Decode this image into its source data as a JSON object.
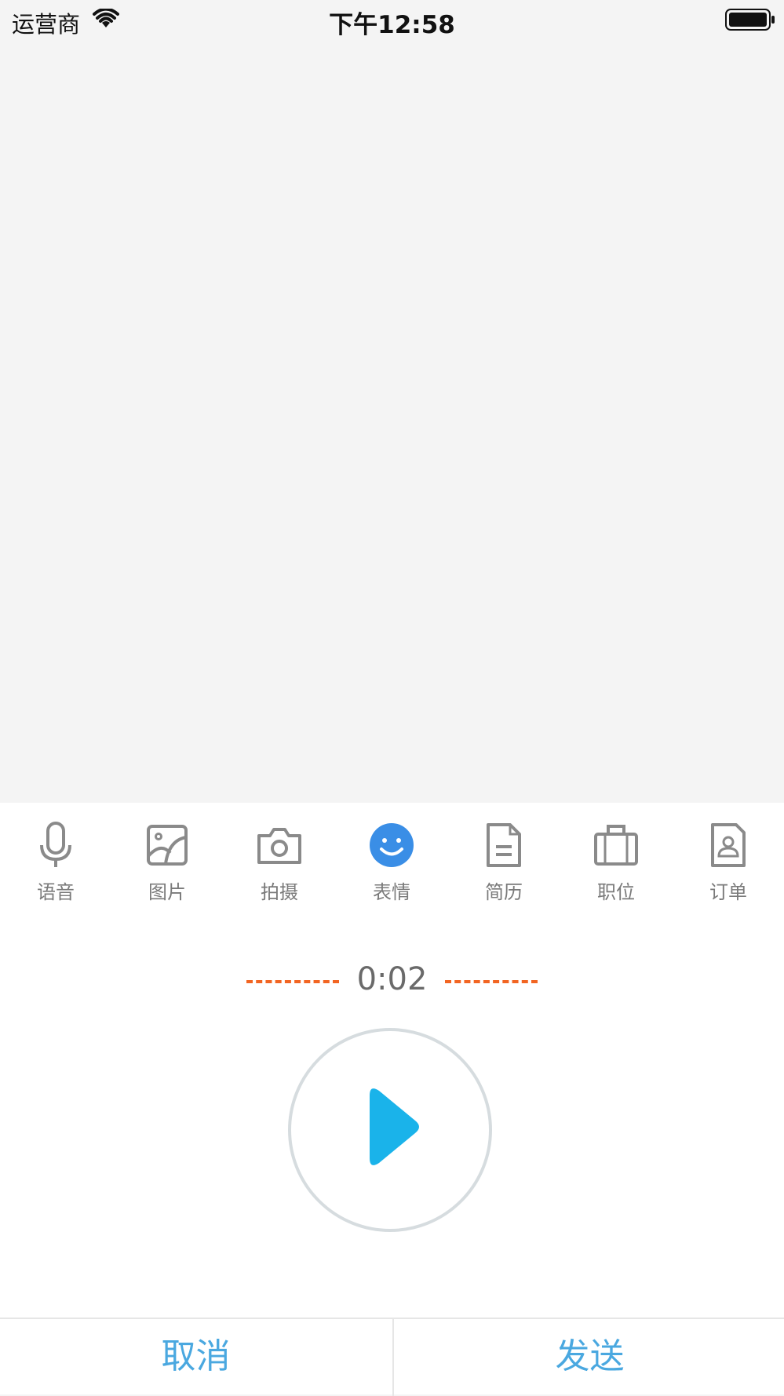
{
  "status_bar": {
    "carrier": "运营商",
    "time": "下午12:58",
    "wifi_icon": "wifi-icon",
    "battery_icon": "battery-icon"
  },
  "toolbar": {
    "items": [
      {
        "label": "语音",
        "icon": "microphone-icon",
        "active": false
      },
      {
        "label": "图片",
        "icon": "image-icon",
        "active": false
      },
      {
        "label": "拍摄",
        "icon": "camera-icon",
        "active": false
      },
      {
        "label": "表情",
        "icon": "emoji-icon",
        "active": true
      },
      {
        "label": "简历",
        "icon": "document-icon",
        "active": false
      },
      {
        "label": "职位",
        "icon": "briefcase-icon",
        "active": false
      },
      {
        "label": "订单",
        "icon": "order-icon",
        "active": false
      }
    ]
  },
  "recorder": {
    "duration": "0:02",
    "play_icon": "play-icon"
  },
  "actions": {
    "cancel": "取消",
    "send": "发送"
  },
  "colors": {
    "accent_blue": "#1ab3ea",
    "emoji_blue": "#3a8ee6",
    "dash_orange": "#f26522",
    "action_text": "#4aa8e0",
    "icon_gray": "#8a8a8a"
  }
}
